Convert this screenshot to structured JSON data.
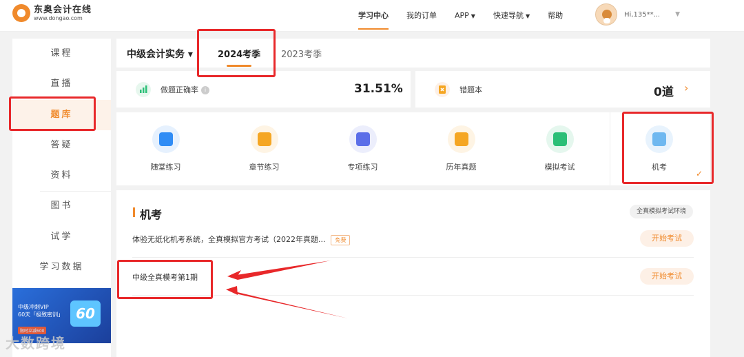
{
  "header": {
    "logo_name": "东奥会计在线",
    "logo_url": "www.dongao.com",
    "nav": [
      {
        "label": "学习中心",
        "active": true
      },
      {
        "label": "我的订单"
      },
      {
        "label": "APP",
        "caret": "▼"
      },
      {
        "label": "快速导航",
        "caret": "▼"
      },
      {
        "label": "帮助"
      }
    ],
    "user_name": "Hi,135**...",
    "user_caret": "▼"
  },
  "sidebar": {
    "items": [
      "课程",
      "直播",
      "题库",
      "答疑",
      "资料",
      "图书",
      "试学",
      "学习数据"
    ],
    "active": "题库",
    "banner": {
      "line1": "中级冲刺VIP",
      "line2": "60天「极致密训」",
      "badge": "60",
      "small": "限时立减600"
    }
  },
  "watermark": "大数跨境",
  "tabbar": {
    "subject": "中级会计实务",
    "subject_caret": "▾",
    "tabs": [
      "2024考季",
      "2023考季"
    ],
    "active_tab": "2024考季"
  },
  "stats": {
    "accuracy_label": "做题正确率",
    "accuracy_value": "31.51%",
    "info_icon": "i",
    "wrongbook_label": "错题本",
    "wrongbook_value": "0道",
    "chevron": "›"
  },
  "practice": {
    "items": [
      {
        "label": "随堂练习",
        "icon": "video-icon",
        "color": "#2f8cf5"
      },
      {
        "label": "章节练习",
        "icon": "book-icon",
        "color": "#f5a623"
      },
      {
        "label": "专项练习",
        "icon": "list-icon",
        "color": "#5b6ee8"
      },
      {
        "label": "历年真题",
        "icon": "paper-icon",
        "color": "#f5a623"
      },
      {
        "label": "模拟考试",
        "icon": "clock-icon",
        "color": "#2bbf77"
      },
      {
        "label": "机考",
        "icon": "computer-icon",
        "color": "#6fb8f0",
        "selected": true
      }
    ],
    "check": "✓"
  },
  "exam": {
    "title": "机考",
    "env_button": "全真模拟考试环境",
    "rows": [
      {
        "text": "体验无纸化机考系统，全真模拟官方考试（2022年真题...",
        "badge": "免费",
        "button": "开始考试"
      },
      {
        "text": "中级全真模考第1期",
        "button": "开始考试"
      }
    ]
  },
  "colors": {
    "accent": "#f08a2c",
    "annotation": "#e8282a"
  }
}
